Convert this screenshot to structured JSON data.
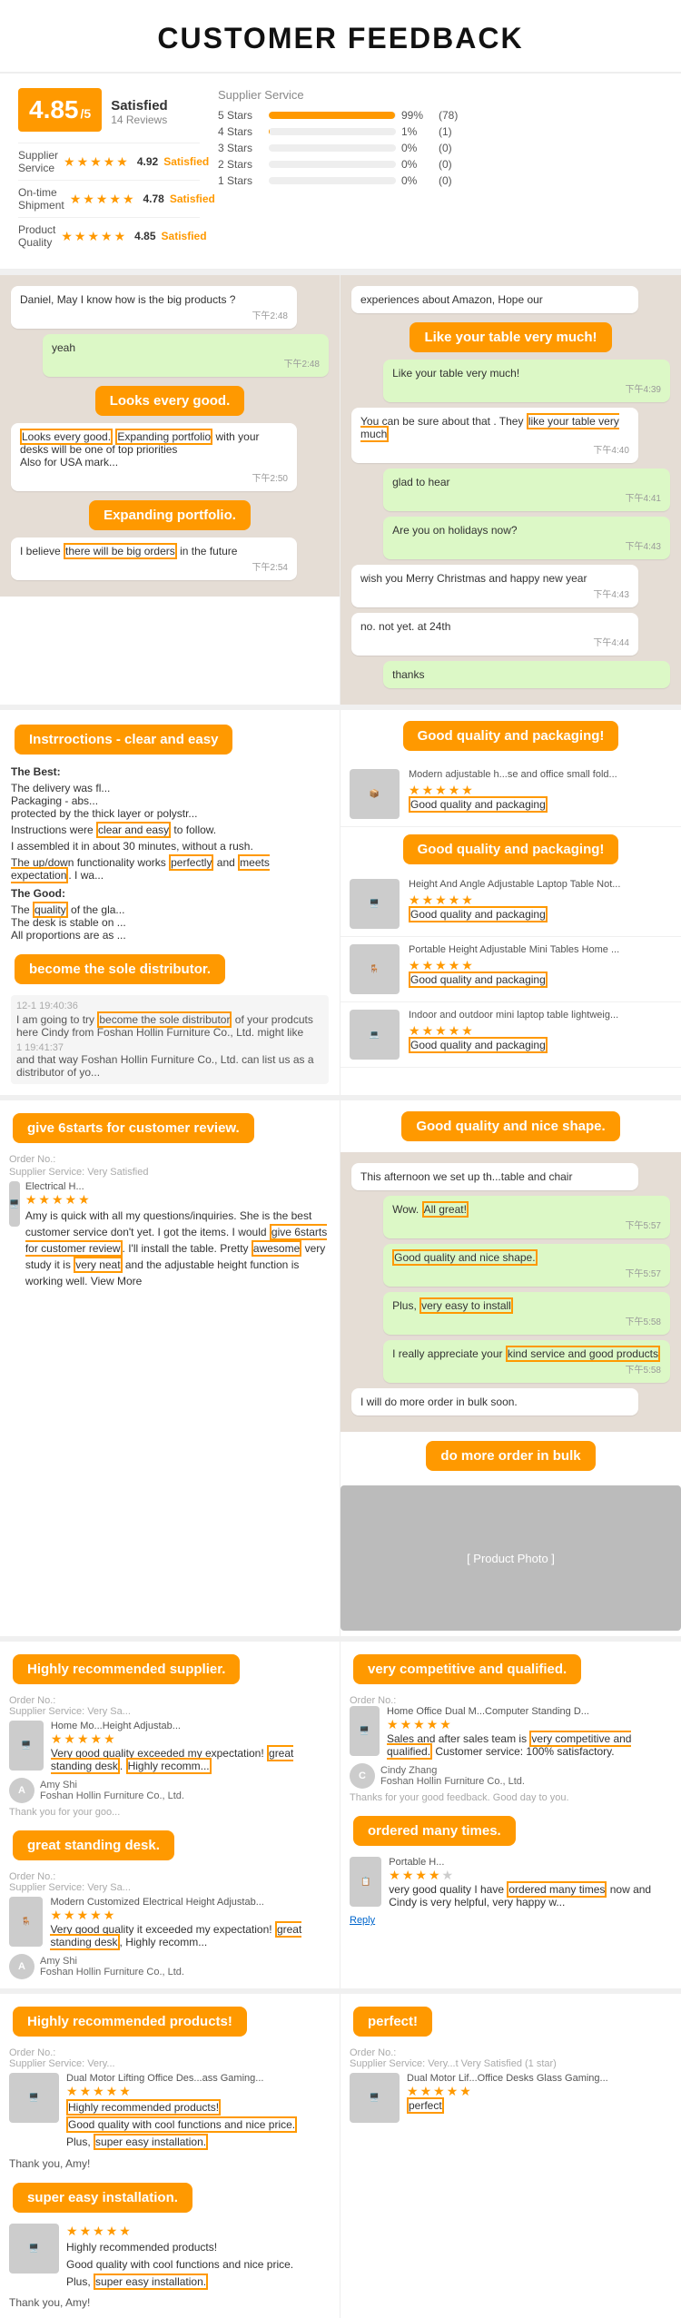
{
  "header": {
    "title": "CUSTOMER FEEDBACK"
  },
  "rating": {
    "score": "4.85",
    "denom": "/5",
    "label": "Satisfied",
    "reviews": "14 Reviews",
    "categories": [
      {
        "name": "Supplier Service",
        "score": "4.92",
        "status": "Satisfied"
      },
      {
        "name": "On-time Shipment",
        "score": "4.78",
        "status": "Satisfied"
      },
      {
        "name": "Product Quality",
        "score": "4.85",
        "status": "Satisfied"
      }
    ],
    "supplier_service_title": "Supplier Service",
    "star_bars": [
      {
        "label": "5 Stars",
        "pct": 99,
        "pct_label": "99%",
        "count": "(78)"
      },
      {
        "label": "4 Stars",
        "pct": 1,
        "pct_label": "1%",
        "count": "(1)"
      },
      {
        "label": "3 Stars",
        "pct": 0,
        "pct_label": "0%",
        "count": "(0)"
      },
      {
        "label": "2 Stars",
        "pct": 0,
        "pct_label": "0%",
        "count": "(0)"
      },
      {
        "label": "1 Stars",
        "pct": 0,
        "pct_label": "0%",
        "count": "(0)"
      }
    ]
  },
  "callouts": {
    "like_table": "Like your table very much!",
    "looks_good": "Looks every good.",
    "expanding": "Expanding portfolio.",
    "instructions": "Instrroctions - clear and easy",
    "sole_distributor": "become the sole distributor.",
    "good_quality_pkg1": "Good quality and packaging!",
    "good_quality_pkg2": "Good quality and packaging!",
    "six_stars": "give 6starts for customer review.",
    "good_quality_shape": "Good quality and nice shape.",
    "highly_recommended": "Highly recommended supplier.",
    "great_standing": "great standing desk.",
    "highly_rec_products": "Highly recommended products!",
    "do_more_order": "do more order in bulk",
    "very_competitive": "very competitive and qualified.",
    "ordered_many": "ordered many times.",
    "super_easy": "super easy installation.",
    "perfect": "perfect!"
  },
  "chat": {
    "messages_left": [
      {
        "text": "Daniel, May I know how is the big products ?",
        "time": "下午2:48",
        "type": "received"
      },
      {
        "text": "yeah",
        "time": "下午2:48",
        "type": "sent"
      },
      {
        "text": "Looks every good. Expanding portfolio with your desks will be one of top priorities\nAlso for USA mark...",
        "time": "下午2:50",
        "type": "received"
      },
      {
        "text": "I believe there will be big orders in the future",
        "time": "下午2:54",
        "type": "received"
      }
    ],
    "messages_right": [
      {
        "text": "experiences about Amazon, Hope our",
        "time": "",
        "type": "received"
      },
      {
        "text": "Like your table very much!",
        "time": "下午4:39",
        "type": "sent"
      },
      {
        "text": "You can be sure about that . They like your table very much",
        "time": "下午4:40",
        "type": "received"
      },
      {
        "text": "glad to hear",
        "time": "下午4:41",
        "type": "sent"
      },
      {
        "text": "Are you on holidays now?",
        "time": "下午4:43",
        "type": "sent"
      },
      {
        "text": "wish you Merry Christmas and happy new year",
        "time": "下午4:43",
        "type": "received"
      },
      {
        "text": "no. not yet. at 24th",
        "time": "下午4:44",
        "type": "received"
      },
      {
        "text": "thanks",
        "time": "",
        "type": "sent"
      }
    ]
  },
  "reviews_section1": {
    "left_review": {
      "best": "The Best:\nThe delivery was fl...\nPackaging - abs...\nprotected by the thick layer or polystr...",
      "instructions_note": "Instructions were clear and easy to follow.",
      "assembly": "I assembled it in about 30 minutes, without a rush.",
      "functionality": "The up/down functionality works perfectly and meets expectation. I wa...",
      "good": "The Good:\nThe quality of the gla...\nThe desk is stable on ...\nAll proportions are as ..."
    }
  },
  "product_reviews": [
    {
      "name": "Modern adjustable h...se and office small fold...",
      "stars": 5,
      "text": "Good quality and packaging"
    },
    {
      "name": "Height And Angle Adjustable Laptop Table Not...",
      "stars": 5,
      "text": "Good quality and packaging"
    },
    {
      "name": "Portable Height Adjustable Mini Tables Home ...",
      "stars": 5,
      "text": "Good quality and packaging"
    },
    {
      "name": "Indoor and outdoor mini laptop table lightweig...",
      "stars": 5,
      "text": "Good quality and packaging"
    }
  ],
  "chat2": {
    "left_order": "Order No.:",
    "left_supplier": "Supplier Service: Very Satisfied",
    "left_product": "Electrical H...",
    "left_stars": 5,
    "left_review_text": "Amy is quick with all my questions/inquiries. She is the best customer service don't yet. I got the items. I would give 6starts for customer review. I'll install the table . Pretty awesome very study it is very neat and the adjustable height function is working well. View More",
    "right_msg1": "This afternoon we set up th...table and chair",
    "right_msg2": "Wow. All great!",
    "right_msg3": "Good quality and nice shape.",
    "right_msg4": "Plus, very easy to install",
    "right_msg5": "I really appreciate your kind service and good products",
    "right_msg6": "I will do more order in bulk soon."
  },
  "review_rows": [
    {
      "order_label": "Order No.:",
      "supplier_label": "Supplier Service: Very Sa...",
      "product": "Home Mo...Height Adjustab...",
      "stars": 5,
      "text": "Very good quality exceeded my expectation! great standing desk. Highly recomm...",
      "highlight": "great standing desk",
      "reviewer_name": "Amy Shi",
      "reviewer_company": "Foshan Hollin Furniture Co., Ltd.",
      "thank_you": "Thank you for your goo..."
    },
    {
      "order_label": "Order No.:",
      "supplier_label": "Supplier Service: Very Sa...",
      "product": "Modern Customized Electrical Height Adjustab...",
      "stars": 5,
      "text": "Very good quality it exceeded my expectation! great standing desk, Highly recomm...",
      "highlight": "great standing desk",
      "reviewer_name": "Amy Shi",
      "reviewer_company": "Foshan Hollin Furniture Co., Ltd."
    }
  ],
  "section_right_competitive": {
    "order_label": "Order No.:",
    "product": "Home Office Dual M...Computer Standing D...",
    "stars": 5,
    "review_text": "Sales and after sales team is very competitive and qualified. Customer service: 100% satisfactory.",
    "highlight": "very competitive and qualified",
    "reviewer_name": "Cindy Zhang",
    "reviewer_company": "Foshan Hollin Furniture Co., Ltd.",
    "thanks": "Thanks for your good feedback. Good day to you."
  },
  "section_right_ordered": {
    "product": "Portable H...",
    "stars": 4,
    "review_text": "very good quality I have ordered many times now and Cindy is very helpful, very happy w...",
    "highlight": "ordered many times"
  },
  "section_bottom_left": {
    "order_label": "Order No.:",
    "supplier_label": "Supplier Service: Very...",
    "product": "Dual Motor Lifting Office Des...ass Gaming...",
    "stars": 5,
    "text1": "Highly recommended products!",
    "text2": "Good quality with cool functions and nice price.",
    "text3": "Plus, super easy installation.",
    "highlight1": "Highly recommended products!",
    "highlight2": "Good quality with cool functions and nice price.",
    "highlight3": "super easy installation",
    "thank_you": "Thank you, Amy!"
  },
  "section_bottom_right": {
    "order_label": "Order No.:",
    "supplier_label": "Supplier Service: Very...t Very Satisfied (1 star)",
    "product": "Dual Motor Lif...Office Desks Glass Gaming...",
    "stars": 5,
    "review_text": "perfect",
    "highlight": "perfect"
  }
}
